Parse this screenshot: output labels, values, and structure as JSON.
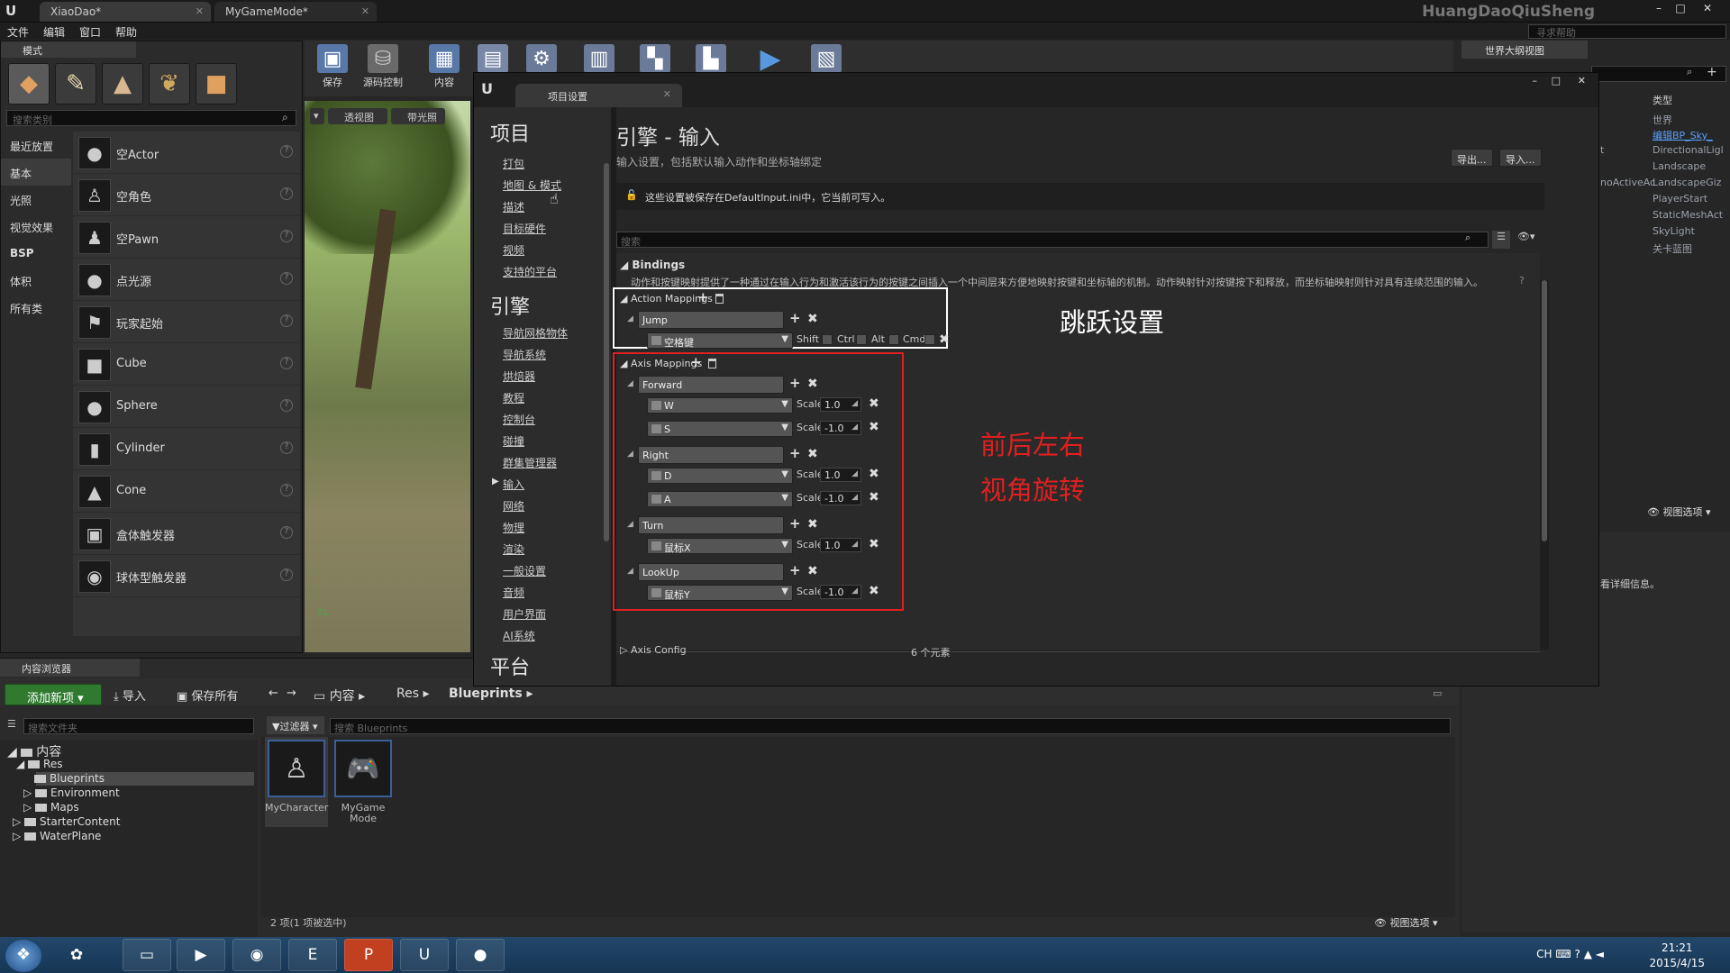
{
  "titlebar": {
    "tabs": [
      "XiaoDao*",
      "MyGameMode*"
    ],
    "brand": "HuangDaoQiuSheng",
    "help_placeholder": "寻求帮助"
  },
  "menu": [
    "文件",
    "编辑",
    "窗口",
    "帮助"
  ],
  "modes": {
    "tab": "模式",
    "search_placeholder": "搜索类别",
    "categories": [
      "最近放置",
      "基本",
      "光照",
      "视觉效果",
      "BSP",
      "体积",
      "所有类"
    ],
    "items": [
      "空Actor",
      "空角色",
      "空Pawn",
      "点光源",
      "玩家起始",
      "Cube",
      "Sphere",
      "Cylinder",
      "Cone",
      "盒体触发器",
      "球体型触发器"
    ]
  },
  "toolbar": {
    "buttons": [
      "保存",
      "源码控制",
      "内容"
    ]
  },
  "viewport": {
    "buttons": [
      "透视图",
      "带光照"
    ]
  },
  "settings": {
    "tab": "项目设置",
    "nav": {
      "project_header": "项目",
      "project_items": [
        "打包",
        "地图 & 模式",
        "描述",
        "目标硬件",
        "视频",
        "支持的平台"
      ],
      "engine_header": "引擎",
      "engine_items": [
        "导航网格物体",
        "导航系统",
        "烘焙器",
        "教程",
        "控制台",
        "碰撞",
        "群集管理器",
        "输入",
        "网络",
        "物理",
        "渲染",
        "一般设置",
        "音频",
        "用户界面",
        "AI系统"
      ],
      "platform_header": "平台"
    },
    "title": "引擎 - 输入",
    "subtitle": "输入设置，包括默认输入动作和坐标轴绑定",
    "export_label": "导出...",
    "import_label": "导入...",
    "notice": "这些设置被保存在DefaultInput.ini中，它当前可写入。",
    "search_placeholder": "搜索",
    "bindings": {
      "header": "Bindings",
      "desc": "动作和按键映射提供了一种通过在输入行为和激活该行为的按键之间插入一个中间层来方便地映射按键和坐标轴的机制。动作映射针对按键按下和释放，而坐标轴映射则针对具有连续范围的输入。"
    },
    "action": {
      "header": "Action Mappings",
      "name": "Jump",
      "key": "空格键",
      "mods": [
        "Shift",
        "Ctrl",
        "Alt",
        "Cmd"
      ]
    },
    "axis": {
      "header": "Axis Mappings",
      "scale_label": "Scale",
      "groups": [
        {
          "name": "Forward",
          "keys": [
            {
              "key": "W",
              "scale": "1.0"
            },
            {
              "key": "S",
              "scale": "-1.0"
            }
          ]
        },
        {
          "name": "Right",
          "keys": [
            {
              "key": "D",
              "scale": "1.0"
            },
            {
              "key": "A",
              "scale": "-1.0"
            }
          ]
        },
        {
          "name": "Turn",
          "keys": [
            {
              "key": "鼠标X",
              "scale": "1.0"
            }
          ]
        },
        {
          "name": "LookUp",
          "keys": [
            {
              "key": "鼠标Y",
              "scale": "-1.0"
            }
          ]
        }
      ]
    },
    "axis_config": "Axis Config",
    "axis_config_count": "6 个元素",
    "annotations": {
      "jump": "跳跃设置",
      "move": "前后左右",
      "turn": "视角旋转"
    }
  },
  "outliner": {
    "tab": "世界大纲视图",
    "col_type": "类型",
    "items": [
      "世界",
      "编辑BP_Sky_",
      "DirectionalLigl",
      "Landscape",
      "LandscapeGiz",
      "PlayerStart",
      "StaticMeshAct",
      "SkyLight",
      "关卡蓝图"
    ],
    "left_trunc": [
      "t",
      "noActiveAc"
    ],
    "view_options": "视图选项",
    "details_text": "看详细信息。"
  },
  "content_browser": {
    "tab": "内容浏览器",
    "add_new": "添加新项",
    "import": "导入",
    "save_all": "保存所有",
    "crumbs": [
      "内容",
      "Res",
      "Blueprints"
    ],
    "folder_search": "搜索文件夹",
    "filter": "过滤器",
    "asset_search": "搜索 Blueprints",
    "tree": [
      "内容",
      "Res",
      "Blueprints",
      "Environment",
      "Maps",
      "StarterContent",
      "WaterPlane"
    ],
    "assets": [
      {
        "name": "MyCharacter"
      },
      {
        "name": "MyGame Mode"
      }
    ],
    "status": "2 项(1 项被选中)",
    "view_options": "视图选项"
  },
  "taskbar": {
    "time": "21:21",
    "date": "2015/4/15",
    "lang": "CH"
  }
}
